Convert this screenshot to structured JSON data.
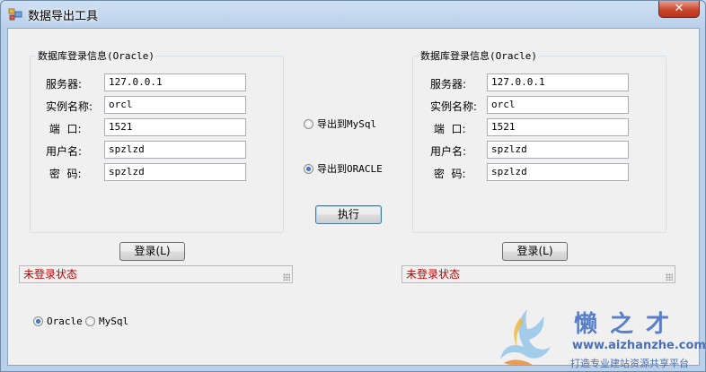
{
  "window": {
    "title": "数据导出工具",
    "close_label": "✕",
    "icon": "app-window-icon"
  },
  "left_panel": {
    "group_title": "数据库登录信息(Oracle)",
    "fields": [
      {
        "label": "服务器:",
        "value": "127.0.0.1"
      },
      {
        "label": "实例名称:",
        "value": "orcl"
      },
      {
        "label": " 端  口:",
        "value": "1521"
      },
      {
        "label": "用户名:",
        "value": "spzlzd"
      },
      {
        "label": " 密  码:",
        "value": "spzlzd"
      }
    ],
    "login_button": "登录(L)",
    "status": "未登录状态"
  },
  "right_panel": {
    "group_title": "数据库登录信息(Oracle)",
    "fields": [
      {
        "label": "服务器:",
        "value": "127.0.0.1"
      },
      {
        "label": "实例名称:",
        "value": "orcl"
      },
      {
        "label": " 端  口:",
        "value": "1521"
      },
      {
        "label": "用户名:",
        "value": "spzlzd"
      },
      {
        "label": " 密  码:",
        "value": "spzlzd"
      }
    ],
    "login_button": "登录(L)",
    "status": "未登录状态"
  },
  "export_options": {
    "mysql_label": "导出到MySql",
    "oracle_label": "导出到ORACLE",
    "selected": "oracle"
  },
  "execute_button": "执行",
  "source_db_options": {
    "oracle_label": "Oracle",
    "mysql_label": "MySql",
    "selected": "oracle"
  },
  "watermark": {
    "brand": "懒之才",
    "url": "www.aizhanzhe.com",
    "slogan": "打造专业建站资源共享平台"
  },
  "colors": {
    "status_text": "#c00000",
    "title_bar": "#b9d0ea",
    "close_button": "#c9462c"
  }
}
